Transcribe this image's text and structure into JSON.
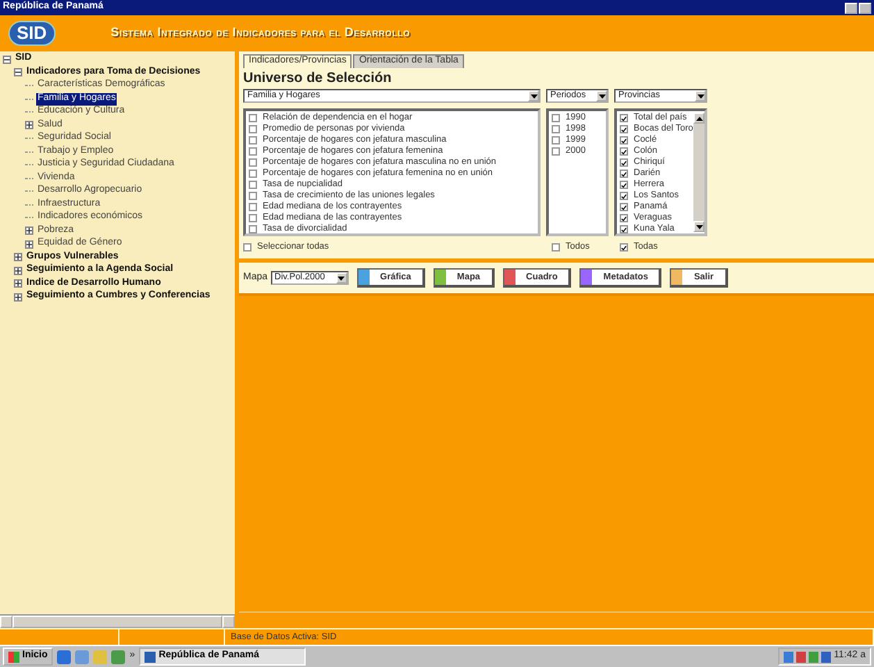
{
  "window": {
    "title": "República de Panamá"
  },
  "header": {
    "logo": "SID",
    "title": "Sistema Integrado de Indicadores para el Desarrollo"
  },
  "tree": [
    {
      "label": "SID",
      "expanded": true,
      "selected": false,
      "children": [
        {
          "label": "Indicadores para Toma de Decisiones",
          "expanded": true,
          "selected": false,
          "children": [
            {
              "label": "Características Demográficas",
              "selected": false
            },
            {
              "label": "Familia y Hogares",
              "selected": true
            },
            {
              "label": "Educación y Cultura",
              "selected": false
            },
            {
              "label": "Salud",
              "expanded": false,
              "selected": false
            },
            {
              "label": "Seguridad Social",
              "selected": false
            },
            {
              "label": "Trabajo y Empleo",
              "selected": false
            },
            {
              "label": "Justicia y Seguridad Ciudadana",
              "selected": false
            },
            {
              "label": "Vivienda",
              "selected": false
            },
            {
              "label": "Desarrollo Agropecuario",
              "selected": false
            },
            {
              "label": "Infraestructura",
              "selected": false
            },
            {
              "label": "Indicadores económicos",
              "selected": false
            },
            {
              "label": "Pobreza",
              "expanded": false,
              "selected": false
            },
            {
              "label": "Equidad de Género",
              "expanded": false,
              "selected": false
            }
          ]
        },
        {
          "label": "Grupos Vulnerables",
          "expanded": false,
          "selected": false
        },
        {
          "label": "Seguimiento a la Agenda Social",
          "expanded": false,
          "selected": false
        },
        {
          "label": "Indice de Desarrollo Humano",
          "expanded": false,
          "selected": false
        },
        {
          "label": "Seguimiento a Cumbres y Conferencias",
          "expanded": false,
          "selected": false
        }
      ]
    }
  ],
  "tabs": [
    {
      "label": "Indicadores/Provincias",
      "selected": true
    },
    {
      "label": "Orientación de la Tabla",
      "selected": false
    }
  ],
  "heading": "Universo de Selección",
  "selects": {
    "topic": "Familia y Hogares",
    "periods": "Periodos",
    "provinces": "Provincias"
  },
  "indicators": [
    {
      "label": "Relación de dependencia en el hogar",
      "checked": false
    },
    {
      "label": "Promedio de personas por vivienda",
      "checked": false
    },
    {
      "label": "Porcentaje de hogares con jefatura masculina",
      "checked": false
    },
    {
      "label": "Porcentaje de hogares con jefatura femenina",
      "checked": false
    },
    {
      "label": "Porcentaje de hogares con jefatura masculina no en unión",
      "checked": false
    },
    {
      "label": "Porcentaje de hogares con jefatura femenina no en unión",
      "checked": false
    },
    {
      "label": "Tasa de nupcialidad",
      "checked": false
    },
    {
      "label": "Tasa de crecimiento de las uniones legales",
      "checked": false
    },
    {
      "label": "Edad mediana de los contrayentes",
      "checked": false
    },
    {
      "label": "Edad mediana de las contrayentes",
      "checked": false
    },
    {
      "label": "Tasa de divorcialidad",
      "checked": false
    }
  ],
  "periods": [
    {
      "label": "1990",
      "checked": false
    },
    {
      "label": "1998",
      "checked": false
    },
    {
      "label": "1999",
      "checked": false
    },
    {
      "label": "2000",
      "checked": false
    }
  ],
  "provinces": [
    {
      "label": "Total del país",
      "checked": true
    },
    {
      "label": "Bocas del Toro",
      "checked": true
    },
    {
      "label": "Coclé",
      "checked": true
    },
    {
      "label": "Colón",
      "checked": true
    },
    {
      "label": "Chiriquí",
      "checked": true
    },
    {
      "label": "Darién",
      "checked": true
    },
    {
      "label": "Herrera",
      "checked": true
    },
    {
      "label": "Los Santos",
      "checked": true
    },
    {
      "label": "Panamá",
      "checked": true
    },
    {
      "label": "Veraguas",
      "checked": true
    },
    {
      "label": "Kuna Yala",
      "checked": true
    }
  ],
  "select_all": [
    {
      "label": "Seleccionar todas",
      "checked": false
    },
    {
      "label": "Todos",
      "checked": false
    },
    {
      "label": "Todas",
      "checked": true
    }
  ],
  "map": {
    "label": "Mapa",
    "value": "Div.Pol.2000"
  },
  "actions": [
    {
      "label": "Gráfica",
      "color": "#4aa3df"
    },
    {
      "label": "Mapa",
      "color": "#7fbf3f"
    },
    {
      "label": "Cuadro",
      "color": "#e05555"
    },
    {
      "label": "Metadatos",
      "color": "#9966ff"
    },
    {
      "label": "Salir",
      "color": "#f0b860"
    }
  ],
  "status_bar": {
    "text": "Base de Datos Activa: SID"
  },
  "taskbar": {
    "start": "Inicio",
    "more": "»",
    "tasks": [
      {
        "label": "República de Panamá",
        "selected": true
      }
    ],
    "clock": "11:42 a"
  }
}
